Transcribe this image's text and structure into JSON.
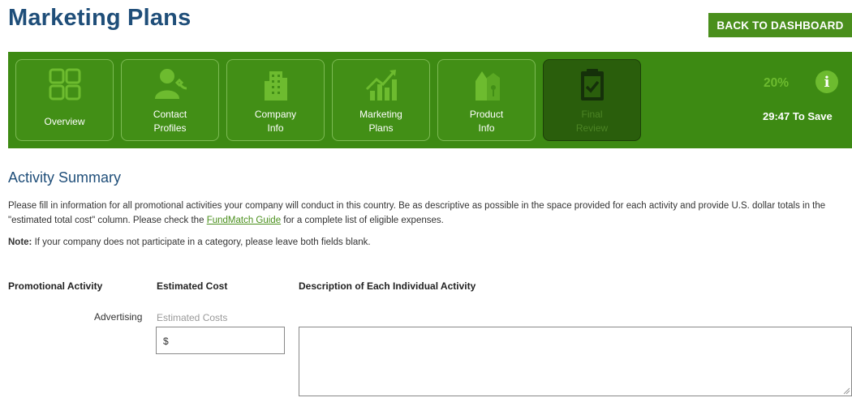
{
  "header": {
    "title": "Marketing Plans",
    "dashboard_button": "BACK TO DASHBOARD"
  },
  "steps": [
    {
      "line1": "Overview",
      "line2": "",
      "icon": "grid-icon"
    },
    {
      "line1": "Contact",
      "line2": "Profiles",
      "icon": "contact-icon"
    },
    {
      "line1": "Company",
      "line2": "Info",
      "icon": "building-icon"
    },
    {
      "line1": "Marketing",
      "line2": "Plans",
      "icon": "chart-icon"
    },
    {
      "line1": "Product",
      "line2": "Info",
      "icon": "product-icon"
    },
    {
      "line1": "Final",
      "line2": "Review",
      "icon": "clipboard-check-icon",
      "active": true
    }
  ],
  "progress": {
    "percent_label": "20%",
    "percent_value": 20,
    "info_icon": "i",
    "save_timer": "29:47 To Save"
  },
  "section": {
    "title": "Activity Summary",
    "instructions_before": "Please fill in information for all promotional activities your company will conduct in this country. Be as descriptive as possible in the space provided for each activity and provide U.S. dollar totals in the \"estimated total cost\" column. Please check the ",
    "instructions_link": "FundMatch Guide",
    "instructions_after": " for a complete list of eligible expenses.",
    "note_label": "Note:",
    "note_text": " If your company does not participate in a category, please leave both fields blank."
  },
  "table": {
    "col_activity": "Promotional Activity",
    "col_cost": "Estimated Cost",
    "col_description": "Description of Each Individual Activity",
    "rows": [
      {
        "activity": "Advertising",
        "cost_label": "Estimated Costs",
        "cost_value": "$",
        "description": ""
      }
    ]
  },
  "colors": {
    "brand_blue": "#1f4e79",
    "brand_green": "#3d8a13",
    "button_green": "#4a8f1c",
    "accent_green": "#6dbb2f"
  }
}
